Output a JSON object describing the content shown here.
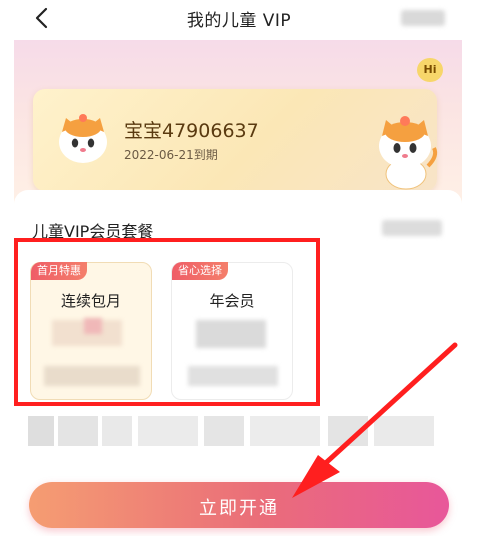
{
  "header": {
    "title": "我的儿童 VIP",
    "back_icon": "chevron-left-icon"
  },
  "badge_hi": "Hi",
  "vip_card": {
    "username": "宝宝47906637",
    "expire": "2022-06-21到期"
  },
  "section": {
    "title": "儿童VIP会员套餐"
  },
  "plans": [
    {
      "badge": "首月特惠",
      "name": "连续包月"
    },
    {
      "badge": "省心选择",
      "name": "年会员"
    }
  ],
  "cta": {
    "label": "立即开通"
  },
  "colors": {
    "accent": "#ea6d79",
    "highlight_border": "#ff1f1f"
  }
}
